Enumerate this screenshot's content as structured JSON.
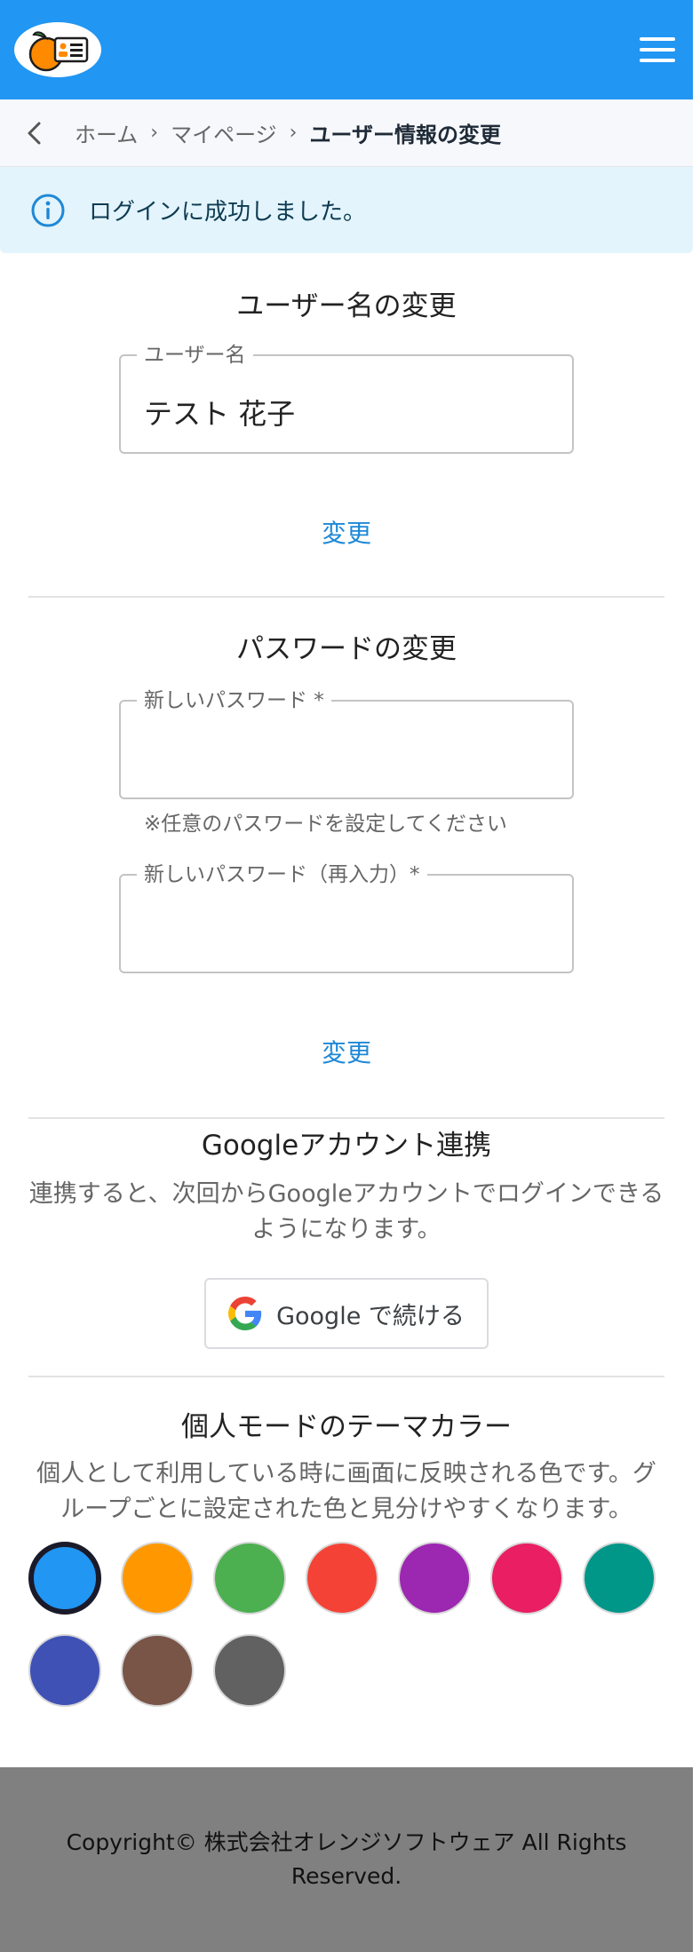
{
  "header": {
    "logo_icon": "orange-id-card-logo",
    "menu_icon": "hamburger-menu-icon"
  },
  "breadcrumb": {
    "back_icon": "chevron-left-icon",
    "home": "ホーム",
    "mypage": "マイページ",
    "current": "ユーザー情報の変更",
    "separator": "›"
  },
  "alert": {
    "icon": "info-icon",
    "message": "ログインに成功しました。"
  },
  "username_section": {
    "title": "ユーザー名の変更",
    "field_label": "ユーザー名",
    "field_value": "テスト 花子",
    "button": "変更"
  },
  "password_section": {
    "title": "パスワードの変更",
    "new_password_label": "新しいパスワード *",
    "new_password_value": "",
    "helper": "※任意のパスワードを設定してください",
    "confirm_label": "新しいパスワード（再入力）*",
    "confirm_value": "",
    "button": "変更"
  },
  "google_section": {
    "title": "Googleアカウント連携",
    "description": "連携すると、次回からGoogleアカウントでログインできるようになります。",
    "button": "Google で続ける",
    "button_icon": "google-g-icon"
  },
  "theme_section": {
    "title": "個人モードのテーマカラー",
    "description": "個人として利用している時に画面に反映される色です。グループごとに設定された色と見分けやすくなります。",
    "selected_color": "#2196f3",
    "colors": [
      "#2196f3",
      "#ff9800",
      "#4caf50",
      "#f44336",
      "#9c27b0",
      "#e91e63",
      "#009688",
      "#3f51b5",
      "#795548",
      "#616161"
    ]
  },
  "footer": {
    "text": "Copyright© 株式会社オレンジソフトウェア All Rights Reserved."
  },
  "colors": {
    "primary": "#2196f3",
    "alert_bg": "#e3f4fc",
    "link": "#1e88d6",
    "footer_bg": "#808080"
  }
}
